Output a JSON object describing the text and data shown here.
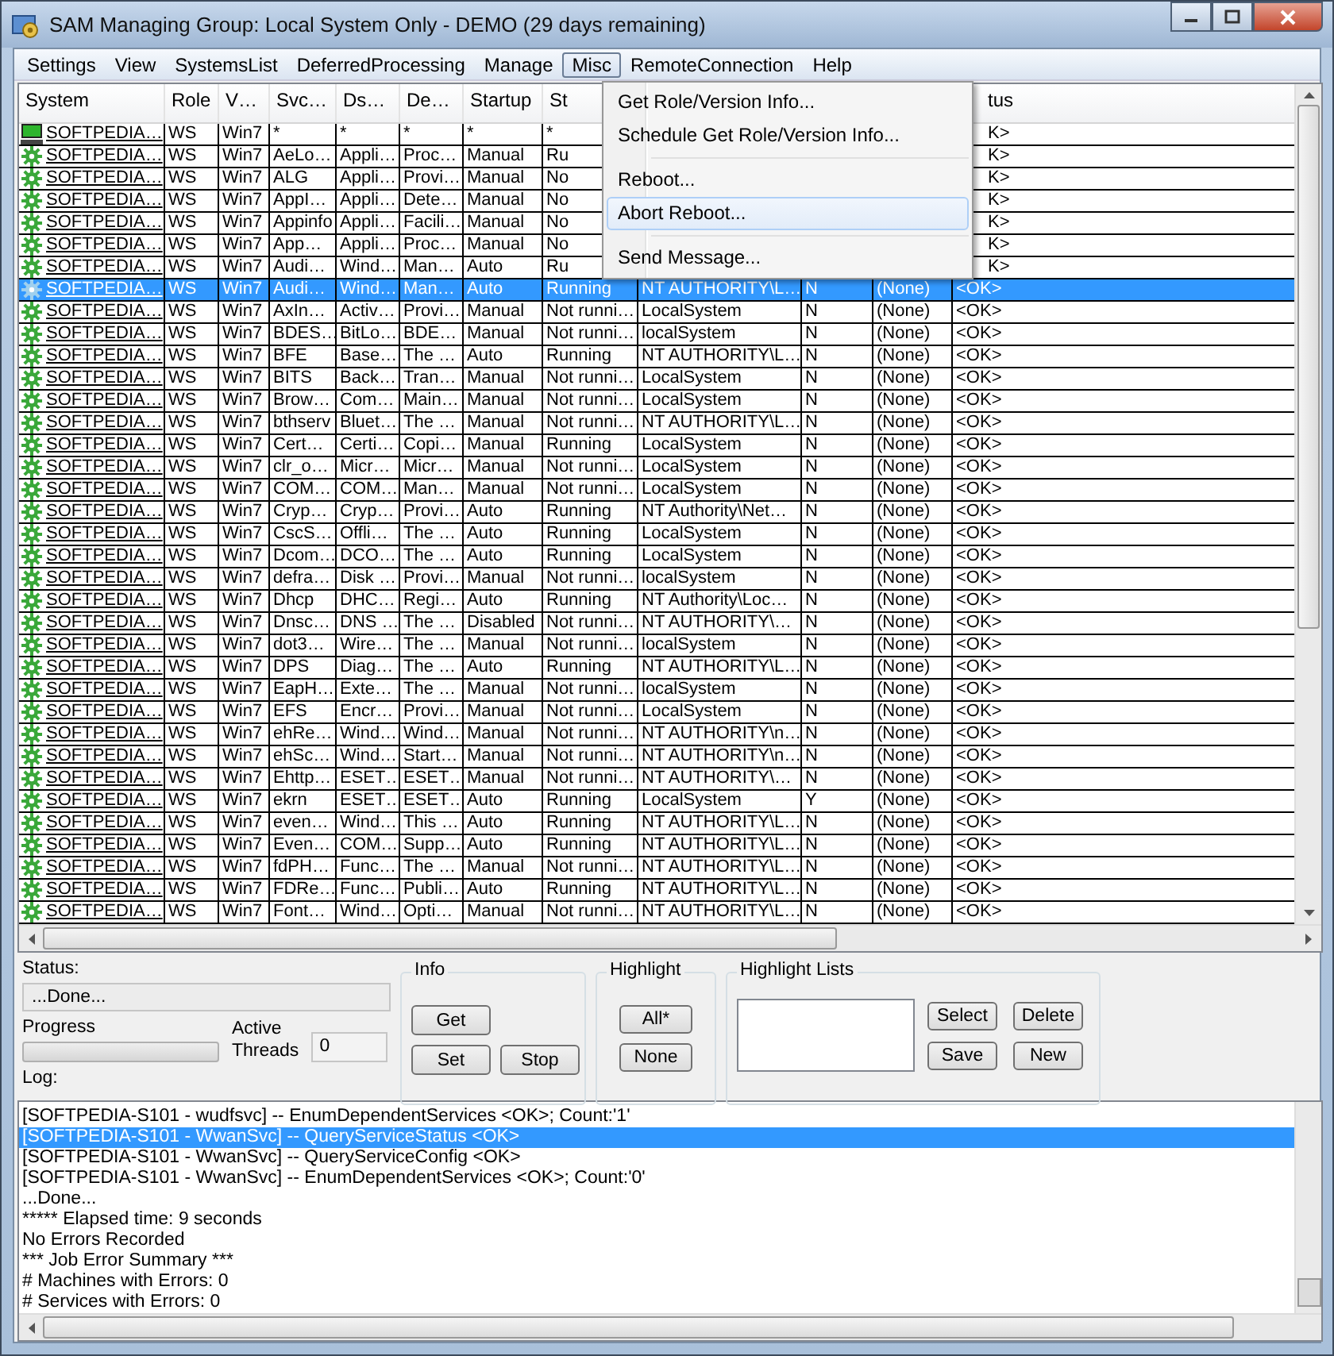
{
  "window": {
    "title": "SAM Managing Group: Local System Only - DEMO (29 days remaining)"
  },
  "menu": [
    {
      "label": "Settings",
      "selected": false
    },
    {
      "label": "View",
      "selected": false
    },
    {
      "label": "SystemsList",
      "selected": false
    },
    {
      "label": "DeferredProcessing",
      "selected": false
    },
    {
      "label": "Manage",
      "selected": false
    },
    {
      "label": "Misc",
      "selected": true
    },
    {
      "label": "RemoteConnection",
      "selected": false
    },
    {
      "label": "Help",
      "selected": false
    }
  ],
  "dropdown": [
    {
      "kind": "item",
      "label": "Get Role/Version Info...",
      "selected": false
    },
    {
      "kind": "item",
      "label": "Schedule Get Role/Version Info...",
      "selected": false
    },
    {
      "kind": "separator"
    },
    {
      "kind": "item",
      "label": "Reboot...",
      "selected": false
    },
    {
      "kind": "item",
      "label": "Abort Reboot...",
      "selected": true
    },
    {
      "kind": "separator"
    },
    {
      "kind": "item",
      "label": "Send Message...",
      "selected": false
    }
  ],
  "table": {
    "columns": [
      "System",
      "Role",
      "V…",
      "Svc…",
      "Ds…",
      "De…",
      "Startup",
      "St"
    ],
    "column_tail": "tus",
    "rows": [
      {
        "kind": "computer",
        "selected": false,
        "cells": [
          "SOFTPEDIA…",
          "WS",
          "Win7",
          "*",
          "*",
          "*",
          "*",
          "*"
        ],
        "tail": "K>"
      },
      {
        "kind": "service",
        "selected": false,
        "cells": [
          "SOFTPEDIA…",
          "WS",
          "Win7",
          "AeLo…",
          "Appli…",
          "Proc…",
          "Manual",
          "Ru"
        ],
        "tail": "K>"
      },
      {
        "kind": "service",
        "selected": false,
        "cells": [
          "SOFTPEDIA…",
          "WS",
          "Win7",
          "ALG",
          "Appli…",
          "Provi…",
          "Manual",
          "No"
        ],
        "tail": "K>"
      },
      {
        "kind": "service",
        "selected": false,
        "cells": [
          "SOFTPEDIA…",
          "WS",
          "Win7",
          "AppI…",
          "Appli…",
          "Dete…",
          "Manual",
          "No"
        ],
        "tail": "K>"
      },
      {
        "kind": "service",
        "selected": false,
        "cells": [
          "SOFTPEDIA…",
          "WS",
          "Win7",
          "Appinfo",
          "Appli…",
          "Facili…",
          "Manual",
          "No"
        ],
        "tail": "K>"
      },
      {
        "kind": "service",
        "selected": false,
        "cells": [
          "SOFTPEDIA…",
          "WS",
          "Win7",
          "App…",
          "Appli…",
          "Proc…",
          "Manual",
          "No"
        ],
        "tail": "K>"
      },
      {
        "kind": "service",
        "selected": false,
        "cells": [
          "SOFTPEDIA…",
          "WS",
          "Win7",
          "Audi…",
          "Wind…",
          "Man…",
          "Auto",
          "Ru"
        ],
        "tail": "K>"
      },
      {
        "kind": "service",
        "selected": true,
        "cells": [
          "SOFTPEDIA…",
          "WS",
          "Win7",
          "Audi…",
          "Wind…",
          "Man…",
          "Auto",
          "Running",
          "NT AUTHORITY\\L…",
          "N",
          "(None)",
          "<OK>"
        ]
      },
      {
        "kind": "service",
        "selected": false,
        "cells": [
          "SOFTPEDIA…",
          "WS",
          "Win7",
          "AxIn…",
          "Activ…",
          "Provi…",
          "Manual",
          "Not runni…",
          "LocalSystem",
          "N",
          "(None)",
          "<OK>"
        ]
      },
      {
        "kind": "service",
        "selected": false,
        "cells": [
          "SOFTPEDIA…",
          "WS",
          "Win7",
          "BDES…",
          "BitLo…",
          "BDE…",
          "Manual",
          "Not runni…",
          "localSystem",
          "N",
          "(None)",
          "<OK>"
        ]
      },
      {
        "kind": "service",
        "selected": false,
        "cells": [
          "SOFTPEDIA…",
          "WS",
          "Win7",
          "BFE",
          "Base…",
          "The …",
          "Auto",
          "Running",
          "NT AUTHORITY\\L…",
          "N",
          "(None)",
          "<OK>"
        ]
      },
      {
        "kind": "service",
        "selected": false,
        "cells": [
          "SOFTPEDIA…",
          "WS",
          "Win7",
          "BITS",
          "Back…",
          "Tran…",
          "Manual",
          "Not runni…",
          "LocalSystem",
          "N",
          "(None)",
          "<OK>"
        ]
      },
      {
        "kind": "service",
        "selected": false,
        "cells": [
          "SOFTPEDIA…",
          "WS",
          "Win7",
          "Brow…",
          "Com…",
          "Main…",
          "Manual",
          "Not runni…",
          "LocalSystem",
          "N",
          "(None)",
          "<OK>"
        ]
      },
      {
        "kind": "service",
        "selected": false,
        "cells": [
          "SOFTPEDIA…",
          "WS",
          "Win7",
          "bthserv",
          "Bluet…",
          "The …",
          "Manual",
          "Not runni…",
          "NT AUTHORITY\\L…",
          "N",
          "(None)",
          "<OK>"
        ]
      },
      {
        "kind": "service",
        "selected": false,
        "cells": [
          "SOFTPEDIA…",
          "WS",
          "Win7",
          "Cert…",
          "Certi…",
          "Copi…",
          "Manual",
          "Running",
          "LocalSystem",
          "N",
          "(None)",
          "<OK>"
        ]
      },
      {
        "kind": "service",
        "selected": false,
        "cells": [
          "SOFTPEDIA…",
          "WS",
          "Win7",
          "clr_o…",
          "Micr…",
          "Micr…",
          "Manual",
          "Not runni…",
          "LocalSystem",
          "N",
          "(None)",
          "<OK>"
        ]
      },
      {
        "kind": "service",
        "selected": false,
        "cells": [
          "SOFTPEDIA…",
          "WS",
          "Win7",
          "COM…",
          "COM…",
          "Man…",
          "Manual",
          "Not runni…",
          "LocalSystem",
          "N",
          "(None)",
          "<OK>"
        ]
      },
      {
        "kind": "service",
        "selected": false,
        "cells": [
          "SOFTPEDIA…",
          "WS",
          "Win7",
          "Cryp…",
          "Cryp…",
          "Provi…",
          "Auto",
          "Running",
          "NT Authority\\Net…",
          "N",
          "(None)",
          "<OK>"
        ]
      },
      {
        "kind": "service",
        "selected": false,
        "cells": [
          "SOFTPEDIA…",
          "WS",
          "Win7",
          "CscS…",
          "Offli…",
          "The …",
          "Auto",
          "Running",
          "LocalSystem",
          "N",
          "(None)",
          "<OK>"
        ]
      },
      {
        "kind": "service",
        "selected": false,
        "cells": [
          "SOFTPEDIA…",
          "WS",
          "Win7",
          "Dcom…",
          "DCO…",
          "The …",
          "Auto",
          "Running",
          "LocalSystem",
          "N",
          "(None)",
          "<OK>"
        ]
      },
      {
        "kind": "service",
        "selected": false,
        "cells": [
          "SOFTPEDIA…",
          "WS",
          "Win7",
          "defra…",
          "Disk …",
          "Provi…",
          "Manual",
          "Not runni…",
          "localSystem",
          "N",
          "(None)",
          "<OK>"
        ]
      },
      {
        "kind": "service",
        "selected": false,
        "cells": [
          "SOFTPEDIA…",
          "WS",
          "Win7",
          "Dhcp",
          "DHC…",
          "Regi…",
          "Auto",
          "Running",
          "NT Authority\\Loc…",
          "N",
          "(None)",
          "<OK>"
        ]
      },
      {
        "kind": "service",
        "selected": false,
        "cells": [
          "SOFTPEDIA…",
          "WS",
          "Win7",
          "Dnsc…",
          "DNS …",
          "The …",
          "Disabled",
          "Not runni…",
          "NT AUTHORITY\\…",
          "N",
          "(None)",
          "<OK>"
        ]
      },
      {
        "kind": "service",
        "selected": false,
        "cells": [
          "SOFTPEDIA…",
          "WS",
          "Win7",
          "dot3…",
          "Wire…",
          "The …",
          "Manual",
          "Not runni…",
          "localSystem",
          "N",
          "(None)",
          "<OK>"
        ]
      },
      {
        "kind": "service",
        "selected": false,
        "cells": [
          "SOFTPEDIA…",
          "WS",
          "Win7",
          "DPS",
          "Diag…",
          "The …",
          "Auto",
          "Running",
          "NT AUTHORITY\\L…",
          "N",
          "(None)",
          "<OK>"
        ]
      },
      {
        "kind": "service",
        "selected": false,
        "cells": [
          "SOFTPEDIA…",
          "WS",
          "Win7",
          "EapH…",
          "Exte…",
          "The …",
          "Manual",
          "Not runni…",
          "localSystem",
          "N",
          "(None)",
          "<OK>"
        ]
      },
      {
        "kind": "service",
        "selected": false,
        "cells": [
          "SOFTPEDIA…",
          "WS",
          "Win7",
          "EFS",
          "Encr…",
          "Provi…",
          "Manual",
          "Not runni…",
          "LocalSystem",
          "N",
          "(None)",
          "<OK>"
        ]
      },
      {
        "kind": "service",
        "selected": false,
        "cells": [
          "SOFTPEDIA…",
          "WS",
          "Win7",
          "ehRe…",
          "Wind…",
          "Wind…",
          "Manual",
          "Not runni…",
          "NT AUTHORITY\\n…",
          "N",
          "(None)",
          "<OK>"
        ]
      },
      {
        "kind": "service",
        "selected": false,
        "cells": [
          "SOFTPEDIA…",
          "WS",
          "Win7",
          "ehSc…",
          "Wind…",
          "Start…",
          "Manual",
          "Not runni…",
          "NT AUTHORITY\\n…",
          "N",
          "(None)",
          "<OK>"
        ]
      },
      {
        "kind": "service",
        "selected": false,
        "cells": [
          "SOFTPEDIA…",
          "WS",
          "Win7",
          "Ehttp…",
          "ESET…",
          "ESET…",
          "Manual",
          "Not runni…",
          "NT AUTHORITY\\…",
          "N",
          "(None)",
          "<OK>"
        ]
      },
      {
        "kind": "service",
        "selected": false,
        "cells": [
          "SOFTPEDIA…",
          "WS",
          "Win7",
          "ekrn",
          "ESET…",
          "ESET…",
          "Auto",
          "Running",
          "LocalSystem",
          "Y",
          "(None)",
          "<OK>"
        ]
      },
      {
        "kind": "service",
        "selected": false,
        "cells": [
          "SOFTPEDIA…",
          "WS",
          "Win7",
          "even…",
          "Wind…",
          "This …",
          "Auto",
          "Running",
          "NT AUTHORITY\\L…",
          "N",
          "(None)",
          "<OK>"
        ]
      },
      {
        "kind": "service",
        "selected": false,
        "cells": [
          "SOFTPEDIA…",
          "WS",
          "Win7",
          "Even…",
          "COM…",
          "Supp…",
          "Auto",
          "Running",
          "NT AUTHORITY\\L…",
          "N",
          "(None)",
          "<OK>"
        ]
      },
      {
        "kind": "service",
        "selected": false,
        "cells": [
          "SOFTPEDIA…",
          "WS",
          "Win7",
          "fdPH…",
          "Func…",
          "The …",
          "Manual",
          "Not runni…",
          "NT AUTHORITY\\L…",
          "N",
          "(None)",
          "<OK>"
        ]
      },
      {
        "kind": "service",
        "selected": false,
        "cells": [
          "SOFTPEDIA…",
          "WS",
          "Win7",
          "FDRe…",
          "Func…",
          "Publi…",
          "Auto",
          "Running",
          "NT AUTHORITY\\L…",
          "N",
          "(None)",
          "<OK>"
        ]
      },
      {
        "kind": "service",
        "selected": false,
        "cells": [
          "SOFTPEDIA…",
          "WS",
          "Win7",
          "Font…",
          "Wind…",
          "Opti…",
          "Manual",
          "Not runni…",
          "NT AUTHORITY\\L…",
          "N",
          "(None)",
          "<OK>"
        ]
      }
    ]
  },
  "status": {
    "label": "Status:",
    "value": "...Done..."
  },
  "progress": {
    "label": "Progress",
    "level": 0
  },
  "threads": {
    "label": "Active\nThreads",
    "value": "0"
  },
  "info": {
    "title": "Info",
    "buttons": [
      "Get",
      "Set",
      "Stop"
    ]
  },
  "highlight": {
    "title": "Highlight",
    "buttons": [
      "All*",
      "None"
    ]
  },
  "highlight_lists": {
    "title": "Highlight Lists",
    "buttons": [
      "Select",
      "Delete",
      "Save",
      "New"
    ]
  },
  "log": {
    "label": "Log:",
    "lines": [
      {
        "text": "[SOFTPEDIA-S101 - wudfsvc] -- EnumDependentServices <OK>; Count:'1'",
        "selected": false
      },
      {
        "text": "[SOFTPEDIA-S101 - WwanSvc] -- QueryServiceStatus <OK>",
        "selected": true
      },
      {
        "text": "[SOFTPEDIA-S101 - WwanSvc] -- QueryServiceConfig <OK>",
        "selected": false
      },
      {
        "text": "[SOFTPEDIA-S101 - WwanSvc] -- EnumDependentServices <OK>; Count:'0'",
        "selected": false
      },
      {
        "text": "...Done...",
        "selected": false
      },
      {
        "text": "***** Elapsed time: 9 seconds",
        "selected": false
      },
      {
        "text": "No Errors Recorded",
        "selected": false
      },
      {
        "text": "*** Job Error Summary ***",
        "selected": false
      },
      {
        "text": "# Machines with Errors: 0",
        "selected": false
      },
      {
        "text": "# Services with Errors: 0",
        "selected": false
      }
    ]
  }
}
